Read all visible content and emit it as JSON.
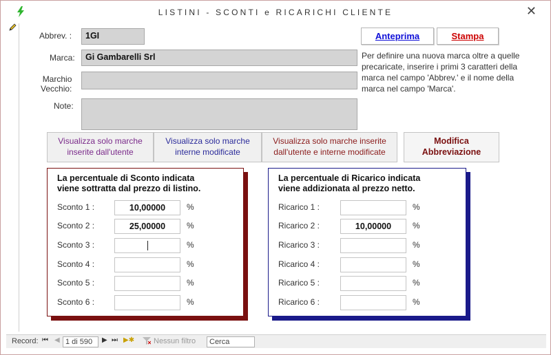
{
  "window": {
    "title": "LISTINI - SCONTI e RICARICHI CLIENTE",
    "close_glyph": "✕"
  },
  "form": {
    "abbrev_label": "Abbrev. :",
    "abbrev_value": "1GI",
    "marca_label": "Marca:",
    "marca_value": "Gi Gambarelli Srl",
    "marchio_label_1": "Marchio",
    "marchio_label_2": "Vecchio:",
    "marchio_value": "",
    "note_label": "Note:",
    "note_value": ""
  },
  "actions": {
    "anteprima": "Anteprima",
    "stampa": "Stampa"
  },
  "hint_lines": [
    "Per definire una nuova marca oltre a quelle",
    "precaricate, inserire i primi 3 caratteri della",
    "marca nel campo 'Abbrev.' e il nome della",
    "marca nel campo 'Marca'."
  ],
  "filters": {
    "btn1_line1": "Visualizza solo marche",
    "btn1_line2": "inserite dall'utente",
    "btn2_line1": "Visualizza solo marche",
    "btn2_line2": "interne modificate",
    "btn3_line1": "Visualizza solo marche inserite",
    "btn3_line2": "dall'utente e interne modificate",
    "btn4_line1": "Modifica",
    "btn4_line2": "Abbreviazione"
  },
  "sconti": {
    "title_line1": "La percentuale di Sconto indicata",
    "title_line2": "viene sottratta dal prezzo di listino.",
    "rows": [
      {
        "label": "Sconto 1 :",
        "value": "10,00000",
        "unit": "%"
      },
      {
        "label": "Sconto 2 :",
        "value": "25,00000",
        "unit": "%"
      },
      {
        "label": "Sconto 3 :",
        "value": "",
        "unit": "%"
      },
      {
        "label": "Sconto 4 :",
        "value": "",
        "unit": "%"
      },
      {
        "label": "Sconto 5 :",
        "value": "",
        "unit": "%"
      },
      {
        "label": "Sconto 6 :",
        "value": "",
        "unit": "%"
      }
    ]
  },
  "ricarichi": {
    "title_line1": "La percentuale di Ricarico indicata",
    "title_line2": "viene addizionata al prezzo netto.",
    "rows": [
      {
        "label": "Ricarico 1 :",
        "value": "",
        "unit": "%"
      },
      {
        "label": "Ricarico 2 :",
        "value": "10,00000",
        "unit": "%"
      },
      {
        "label": "Ricarico 3 :",
        "value": "",
        "unit": "%"
      },
      {
        "label": "Ricarico 4 :",
        "value": "",
        "unit": "%"
      },
      {
        "label": "Ricarico 5 :",
        "value": "",
        "unit": "%"
      },
      {
        "label": "Ricarico 6 :",
        "value": "",
        "unit": "%"
      }
    ]
  },
  "navigation": {
    "record_label": "Record:",
    "first": "⏮",
    "prev": "◀",
    "position": "1 di 590",
    "next": "▶",
    "last": "⏭",
    "new": "▶✱",
    "filter_label": "Nessun filtro",
    "search_value": "Cerca"
  },
  "colors": {
    "sconti_border": "#7a1010",
    "ricarichi_border": "#1a1a8a",
    "accent_green": "#2fb52f"
  }
}
